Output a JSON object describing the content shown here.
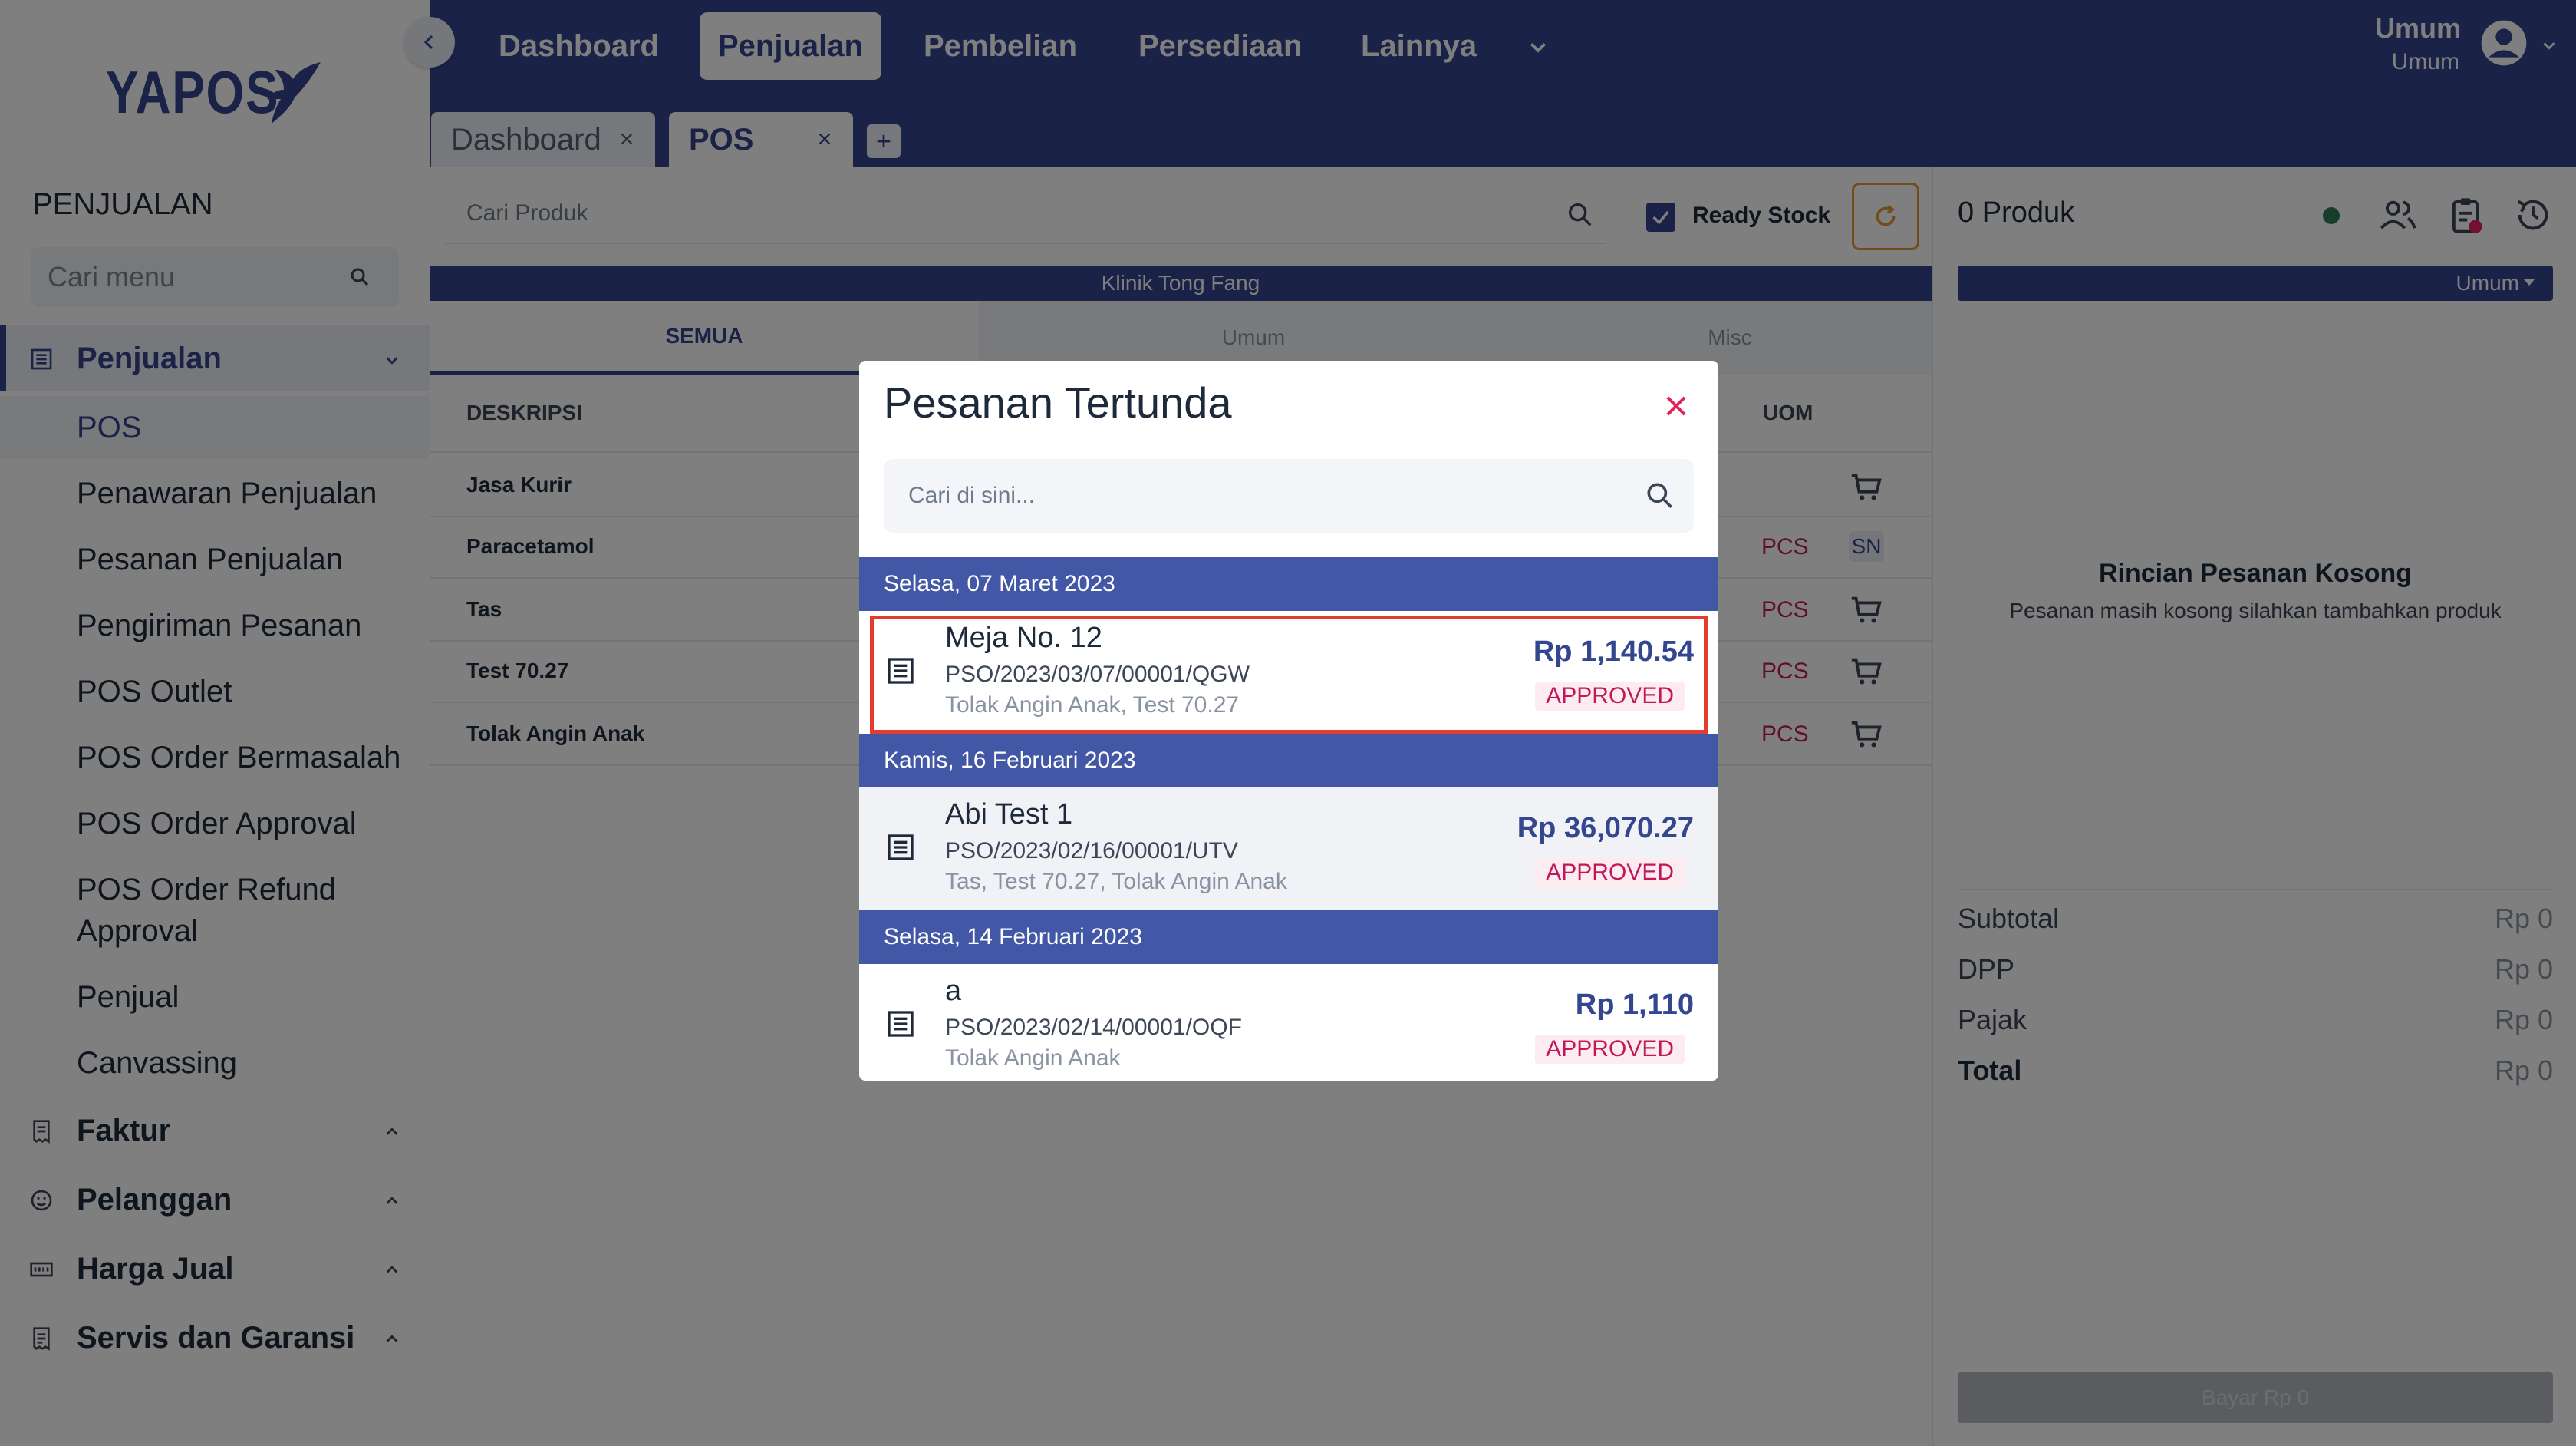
{
  "brand": {
    "name": "YAPOS"
  },
  "sidebar": {
    "heading": "PENJUALAN",
    "search_placeholder": "Cari menu",
    "groups": [
      {
        "label": "Penjualan",
        "icon": "list-icon"
      },
      {
        "label": "Faktur",
        "icon": "invoice-icon"
      },
      {
        "label": "Pelanggan",
        "icon": "customer-icon"
      },
      {
        "label": "Harga Jual",
        "icon": "price-tag-icon"
      },
      {
        "label": "Servis dan Garansi",
        "icon": "service-icon"
      }
    ],
    "penjualan_items": [
      "POS",
      "Penawaran Penjualan",
      "Pesanan Penjualan",
      "Pengiriman Pesanan",
      "POS Outlet",
      "POS Order Bermasalah",
      "POS Order Approval",
      "POS Order Refund",
      "Approval",
      "Penjual",
      "Canvassing"
    ]
  },
  "topnav": {
    "items": [
      "Dashboard",
      "Penjualan",
      "Pembelian",
      "Persediaan",
      "Lainnya"
    ],
    "active": "Penjualan",
    "user_name": "Umum",
    "user_role": "Umum"
  },
  "tabs": {
    "items": [
      "Dashboard",
      "POS"
    ],
    "active": "POS"
  },
  "pos": {
    "search_placeholder": "Cari Produk",
    "ready_stock_label": "Ready Stock",
    "ready_stock_checked": true,
    "branch": "Klinik Tong Fang",
    "categories": [
      "SEMUA",
      "Umum",
      "Misc"
    ],
    "active_category": "SEMUA",
    "columns": {
      "description": "DESKRIPSI",
      "uom": "UOM"
    },
    "products": [
      {
        "name": "Jasa Kurir",
        "uom": "",
        "action": "cart"
      },
      {
        "name": "Paracetamol",
        "uom": "PCS",
        "action": "SN"
      },
      {
        "name": "Tas",
        "uom": "PCS",
        "action": "cart"
      },
      {
        "name": "Test 70.27",
        "uom": "PCS",
        "action": "cart"
      },
      {
        "name": "Tolak Angin Anak",
        "uom": "PCS",
        "action": "cart"
      }
    ]
  },
  "cart": {
    "count_label": "0 Produk",
    "customer": "Umum",
    "empty_title": "Rincian Pesanan Kosong",
    "empty_subtitle": "Pesanan masih kosong silahkan tambahkan produk",
    "summary": [
      {
        "label": "Subtotal",
        "value": "Rp 0"
      },
      {
        "label": "DPP",
        "value": "Rp 0"
      },
      {
        "label": "Pajak",
        "value": "Rp 0"
      },
      {
        "label": "Total",
        "value": "Rp 0"
      }
    ],
    "pay_label": "Bayar Rp 0"
  },
  "modal": {
    "title": "Pesanan Tertunda",
    "search_placeholder": "Cari di sini...",
    "groups": [
      {
        "date": "Selasa, 07 Maret 2023",
        "orders": [
          {
            "name": "Meja No. 12",
            "code": "PSO/2023/03/07/00001/QGW",
            "items": "Tolak Angin Anak, Test 70.27",
            "price": "Rp 1,140.54",
            "status": "APPROVED"
          }
        ]
      },
      {
        "date": "Kamis, 16 Februari 2023",
        "orders": [
          {
            "name": "Abi Test 1",
            "code": "PSO/2023/02/16/00001/UTV",
            "items": "Tas, Test 70.27, Tolak Angin Anak",
            "price": "Rp 36,070.27",
            "status": "APPROVED"
          }
        ]
      },
      {
        "date": "Selasa, 14 Februari 2023",
        "orders": [
          {
            "name": "a",
            "code": "PSO/2023/02/14/00001/OQF",
            "items": "Tolak Angin Anak",
            "price": "Rp 1,110",
            "status": "APPROVED"
          }
        ]
      }
    ]
  },
  "colors": {
    "primary": "#34468f",
    "date_header": "#4257a6",
    "status": "#c2185b",
    "highlight": "#e33d2e",
    "accent_orange": "#e39a3c"
  }
}
